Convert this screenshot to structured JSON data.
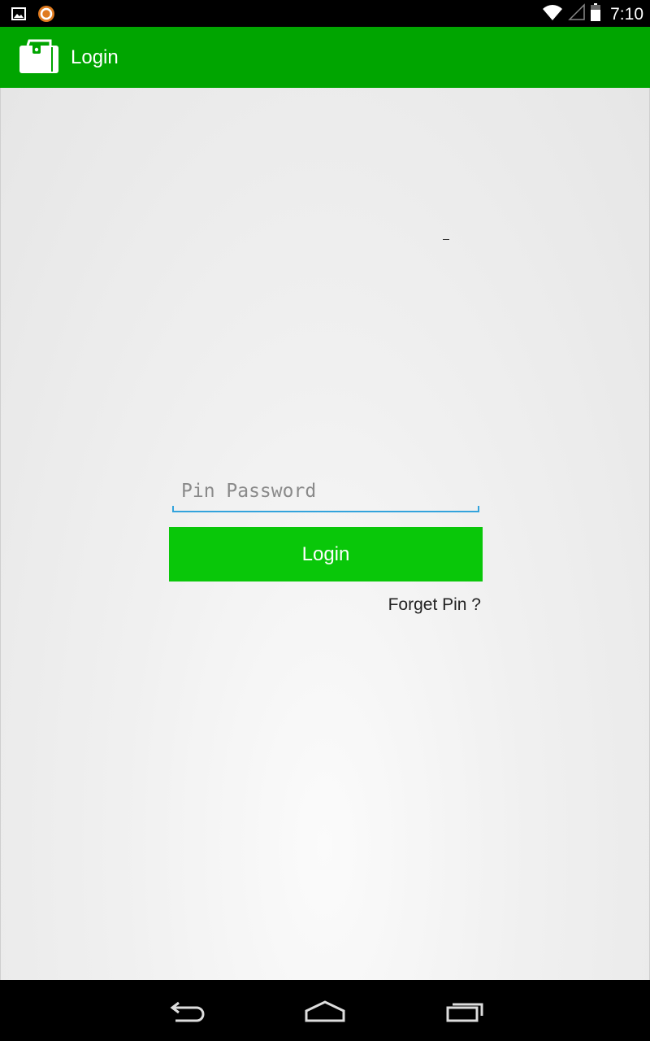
{
  "status_bar": {
    "time": "7:10",
    "icons": [
      "image-notification-icon",
      "app-notification-icon",
      "wifi-icon",
      "signal-icon",
      "battery-icon"
    ]
  },
  "app_bar": {
    "title": "Login",
    "icon": "wallet-icon",
    "background_color": "#00a500"
  },
  "login_form": {
    "pin_placeholder": "Pin Password",
    "pin_value": "",
    "login_button_label": "Login",
    "forget_pin_label": "Forget Pin ?",
    "button_color": "#09c709",
    "focus_color": "#33a3dc"
  },
  "nav_bar": {
    "buttons": [
      "back-icon",
      "home-icon",
      "recent-apps-icon"
    ]
  }
}
